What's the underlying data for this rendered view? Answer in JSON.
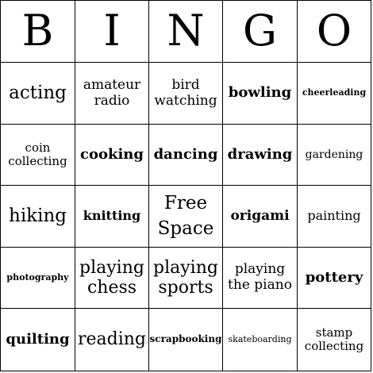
{
  "header": [
    "B",
    "I",
    "N",
    "G",
    "O"
  ],
  "rows": [
    [
      "acting",
      "amateur radio",
      "bird watching",
      "bowling",
      "cheerleading"
    ],
    [
      "coin collecting",
      "cooking",
      "dancing",
      "drawing",
      "gardening"
    ],
    [
      "hiking",
      "knitting",
      "Free Space",
      "origami",
      "painting"
    ],
    [
      "photography",
      "playing chess",
      "playing sports",
      "playing the piano",
      "pottery"
    ],
    [
      "quilting",
      "reading",
      "scrapbooking",
      "skateboarding",
      "stamp collecting"
    ]
  ]
}
